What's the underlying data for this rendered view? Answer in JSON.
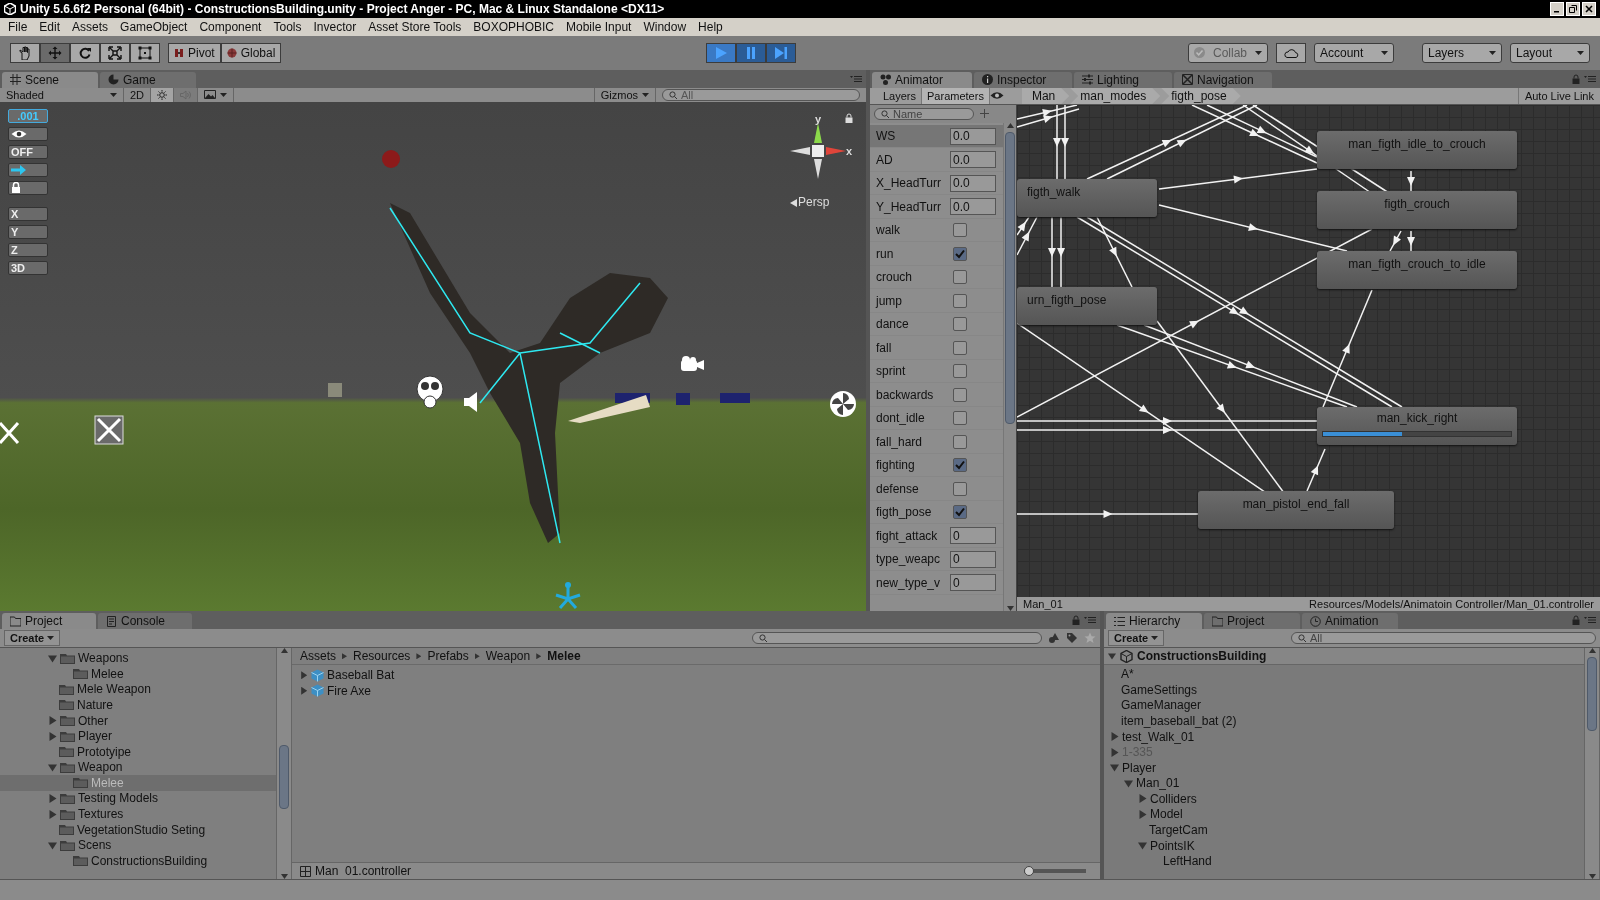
{
  "title_bar": {
    "title": "Unity 5.6.6f2 Personal (64bit) - ConstructionsBuilding.unity - Project Anger - PC, Mac & Linux Standalone <DX11>"
  },
  "menu_bar": [
    "File",
    "Edit",
    "Assets",
    "GameObject",
    "Component",
    "Tools",
    "Invector",
    "Asset Store Tools",
    "BOXOPHOBIC",
    "Mobile Input",
    "Window",
    "Help"
  ],
  "toolbar": {
    "tools": [
      {
        "kind": "hand",
        "selected": false
      },
      {
        "kind": "move",
        "selected": true
      },
      {
        "kind": "rotate",
        "selected": false
      },
      {
        "kind": "scale",
        "selected": false
      },
      {
        "kind": "rect",
        "selected": false
      }
    ],
    "pivot": "Pivot",
    "global": "Global",
    "playing": true,
    "collab": "Collab",
    "account": "Account",
    "layers": "Layers",
    "layout": "Layout"
  },
  "scene_panel": {
    "tabs": [
      {
        "label": "Scene",
        "kind": "scene",
        "selected": true
      },
      {
        "label": "Game",
        "kind": "game",
        "selected": false
      }
    ],
    "shading": "Shaded",
    "mode_2d": "2D",
    "lighting_on": true,
    "audio_on": false,
    "gizmos": "Gizmos",
    "search_placeholder": "All",
    "snap_value": ".001",
    "toggle": "OFF",
    "axes": [
      "X",
      "Y",
      "Z"
    ],
    "view_3d": "3D",
    "gizmo_axes": [
      "y",
      "x"
    ],
    "projection": "Persp"
  },
  "animator": {
    "tabs": [
      {
        "label": "Animator",
        "kind": "animator",
        "selected": true
      },
      {
        "label": "Inspector",
        "kind": "inspector",
        "selected": false
      },
      {
        "label": "Lighting",
        "kind": "lighting",
        "selected": false
      },
      {
        "label": "Navigation",
        "kind": "navigation",
        "selected": false
      }
    ],
    "subtabs": [
      {
        "label": "Layers",
        "selected": false
      },
      {
        "label": "Parameters",
        "selected": true
      }
    ],
    "search_placeholder": "Name",
    "breadcrumb": [
      "Man",
      "man_modes",
      "figth_pose"
    ],
    "live_link": "Auto Live Link",
    "parameters": [
      {
        "name": "WS",
        "kind": "float",
        "value": "0.0",
        "selected": true
      },
      {
        "name": "AD",
        "kind": "float",
        "value": "0.0",
        "selected": false
      },
      {
        "name": "X_HeadTurr",
        "kind": "float",
        "value": "0.0",
        "selected": false
      },
      {
        "name": "Y_HeadTurr",
        "kind": "float",
        "value": "0.0",
        "selected": false
      },
      {
        "name": "walk",
        "kind": "bool",
        "checked": false,
        "selected": false
      },
      {
        "name": "run",
        "kind": "bool",
        "checked": true,
        "selected": false
      },
      {
        "name": "crouch",
        "kind": "bool",
        "checked": false,
        "selected": false
      },
      {
        "name": "jump",
        "kind": "bool",
        "checked": false,
        "selected": false
      },
      {
        "name": "dance",
        "kind": "bool",
        "checked": false,
        "selected": false
      },
      {
        "name": "fall",
        "kind": "bool",
        "checked": false,
        "selected": false
      },
      {
        "name": "sprint",
        "kind": "bool",
        "checked": false,
        "selected": false
      },
      {
        "name": "backwards",
        "kind": "bool",
        "checked": false,
        "selected": false
      },
      {
        "name": "dont_idle",
        "kind": "bool",
        "checked": false,
        "selected": false
      },
      {
        "name": "fall_hard",
        "kind": "bool",
        "checked": false,
        "selected": false
      },
      {
        "name": "fighting",
        "kind": "bool",
        "checked": true,
        "selected": false
      },
      {
        "name": "defense",
        "kind": "bool",
        "checked": false,
        "selected": false
      },
      {
        "name": "figth_pose",
        "kind": "bool",
        "checked": true,
        "selected": false
      },
      {
        "name": "fight_attack",
        "kind": "int",
        "value": "0",
        "selected": false
      },
      {
        "name": "type_weapc",
        "kind": "int",
        "value": "0",
        "selected": false
      },
      {
        "name": "new_type_v",
        "kind": "int",
        "value": "0",
        "selected": false
      }
    ],
    "states": [
      {
        "name": "man_figth_idle_to_crouch"
      },
      {
        "name": "figth_crouch"
      },
      {
        "name": "man_figth_crouch_to_idle"
      },
      {
        "name": "figth_walk"
      },
      {
        "name": "urn_figth_pose"
      },
      {
        "name": "man_kick_right",
        "level": 0.42
      },
      {
        "name": "man_pistol_end_fall"
      }
    ],
    "footer_left": "Man_01",
    "footer_path": "Resources/Models/Animatoin Controller/Man_01.controller"
  },
  "project": {
    "tabs": [
      {
        "label": "Project",
        "kind": "project",
        "selected": true
      },
      {
        "label": "Console",
        "kind": "console",
        "selected": false
      }
    ],
    "create": "Create",
    "folders": [
      {
        "label": "Weapons",
        "kind": "branch",
        "expanded": true,
        "selected": false,
        "children": [
          {
            "label": "Melee",
            "kind": "leaf",
            "selected": false
          }
        ]
      },
      {
        "label": "Mele Weapon",
        "kind": "leaf",
        "selected": false
      },
      {
        "label": "Nature",
        "kind": "leaf",
        "selected": false
      },
      {
        "label": "Other",
        "kind": "branch",
        "expanded": false,
        "selected": false
      },
      {
        "label": "Player",
        "kind": "branch",
        "expanded": false,
        "selected": false
      },
      {
        "label": "Prototyipe",
        "kind": "leaf",
        "selected": false
      },
      {
        "label": "Weapon",
        "kind": "branch",
        "expanded": true,
        "selected": false,
        "children": [
          {
            "label": "Melee",
            "kind": "leaf",
            "selected": true
          }
        ]
      },
      {
        "label": "Testing Models",
        "kind": "branch",
        "expanded": false,
        "selected": false
      },
      {
        "label": "Textures",
        "kind": "branch",
        "expanded": false,
        "selected": false
      },
      {
        "label": "VegetationStudio Seting",
        "kind": "leaf",
        "selected": false
      },
      {
        "label": "Scens",
        "kind": "branch",
        "expanded": true,
        "selected": false,
        "children": [
          {
            "label": "ConstructionsBuilding",
            "kind": "leaf",
            "selected": false
          }
        ]
      }
    ],
    "breadcrumb": [
      "Assets",
      "Resources",
      "Prefabs",
      "Weapon",
      "Melee"
    ],
    "assets": [
      {
        "label": "Baseball Bat",
        "expanded": false
      },
      {
        "label": "Fire Axe",
        "expanded": false
      }
    ],
    "footer": "Man  01.controller",
    "zoom_slider": {
      "level": 0.0
    }
  },
  "hierarchy": {
    "tabs": [
      {
        "label": "Hierarchy",
        "kind": "hierarchy",
        "selected": true
      },
      {
        "label": "Project",
        "kind": "project",
        "selected": false
      },
      {
        "label": "Animation",
        "kind": "animation",
        "selected": false
      }
    ],
    "create": "Create",
    "search_placeholder": "All",
    "scene": "ConstructionsBuilding",
    "items": [
      {
        "label": "A*",
        "kind": "leaf",
        "disabled": false
      },
      {
        "label": "GameSettings",
        "kind": "leaf",
        "disabled": false
      },
      {
        "label": "GameManager",
        "kind": "leaf",
        "disabled": false
      },
      {
        "label": "item_baseball_bat (2)",
        "kind": "leaf",
        "disabled": false
      },
      {
        "label": "test_Walk_01",
        "kind": "branch",
        "expanded": false,
        "disabled": false
      },
      {
        "label": "1-335",
        "kind": "branch",
        "expanded": false,
        "disabled": true
      },
      {
        "label": "Player",
        "kind": "branch",
        "expanded": true,
        "disabled": false,
        "children": [
          {
            "label": "Man_01",
            "kind": "branch",
            "expanded": true,
            "disabled": false,
            "children": [
              {
                "label": "Colliders",
                "kind": "branch",
                "expanded": false,
                "disabled": false
              },
              {
                "label": "Model",
                "kind": "branch",
                "expanded": false,
                "disabled": false
              },
              {
                "label": "TargetCam",
                "kind": "leaf",
                "disabled": false
              },
              {
                "label": "PointsIK",
                "kind": "branch",
                "expanded": true,
                "disabled": false,
                "children": [
                  {
                    "label": "LeftHand",
                    "kind": "leaf",
                    "disabled": false
                  }
                ]
              }
            ]
          }
        ]
      }
    ]
  }
}
